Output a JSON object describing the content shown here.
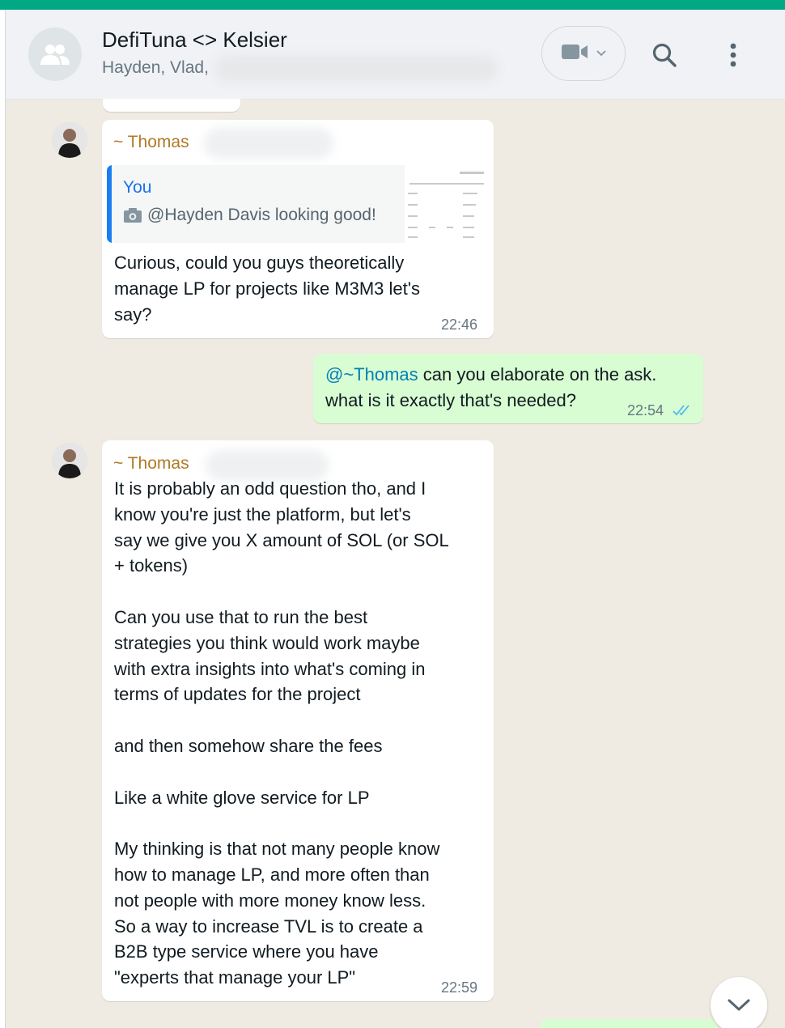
{
  "header": {
    "title": "DefiTuna <> Kelsier",
    "participants": "Hayden, Vlad,"
  },
  "messages": [
    {
      "sender": "~ Thomas",
      "quote": {
        "author": "You",
        "text": "@Hayden Davis looking good!",
        "icon": "camera-icon"
      },
      "text": "Curious, could you guys theoretically\nmanage LP for projects like M3M3 let's\nsay?",
      "time": "22:46"
    },
    {
      "mention": "@~Thomas",
      "text_first": " can you elaborate on the ask.",
      "text_second": "what is it exactly that's needed?",
      "time": "22:54",
      "status": "read"
    },
    {
      "sender": "~ Thomas",
      "text": "It is probably an odd question tho, and I\nknow you're just the platform, but let's\nsay we give you X amount of SOL (or SOL\n+ tokens)\n\nCan you use that to run the best\nstrategies you think would work maybe\nwith extra insights into what's coming in\nterms of updates for the project\n\nand then somehow share the fees\n\nLike a white glove service for LP\n\nMy thinking is that not many people know\nhow to manage LP, and more often than\nnot people with more money know less.\nSo a way to increase TVL is to create a\nB2B type service where you have\n\"experts that manage your LP\"",
      "time": "22:59"
    }
  ],
  "colors": {
    "accent": "#00a884",
    "outgoing_bubble": "#d9fdd3",
    "sender_name": "#b07a24",
    "mention": "#027eb5",
    "read_ticks": "#53bdeb"
  },
  "icons": [
    "group-avatar-icon",
    "video-call-icon",
    "chevron-down-icon",
    "search-icon",
    "menu-icon",
    "double-check-icon",
    "scroll-down-icon"
  ]
}
